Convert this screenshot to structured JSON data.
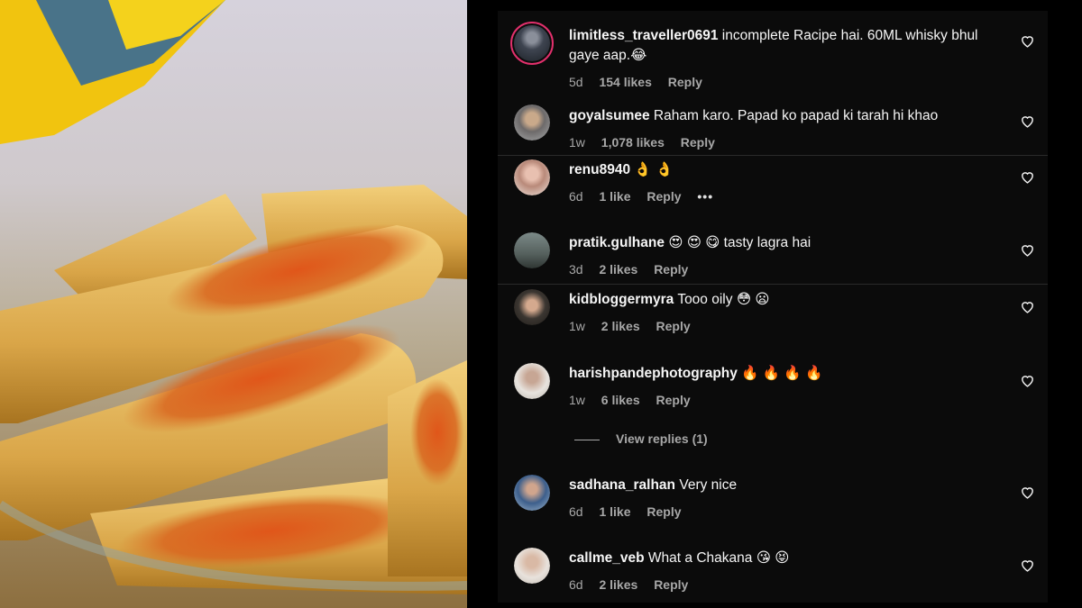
{
  "photo": {
    "description_icon": "food-photo"
  },
  "comments": [
    {
      "username": "limitless_traveller0691",
      "text": "incomplete Racipe hai. 60ML whisky bhul gaye aap.",
      "emoji": "😂",
      "time": "5d",
      "likes": "154 likes",
      "reply": "Reply"
    },
    {
      "username": "goyalsumee",
      "text": "Raham karo. Papad ko papad ki tarah hi khao",
      "emoji": "",
      "time": "1w",
      "likes": "1,078 likes",
      "reply": "Reply"
    },
    {
      "username": "renu8940",
      "text": "",
      "emoji": "👌 👌",
      "time": "6d",
      "likes": "1 like",
      "reply": "Reply",
      "more": "•••"
    },
    {
      "username": "pratik.gulhane",
      "text": "tasty lagra hai",
      "emoji": "😍 😍 😋",
      "time": "3d",
      "likes": "2 likes",
      "reply": "Reply"
    },
    {
      "username": "kidbloggermyra",
      "text": "Tooo oily",
      "emoji": "😳 😦",
      "time": "1w",
      "likes": "2 likes",
      "reply": "Reply"
    },
    {
      "username": "harishpandephotography",
      "text": "",
      "emoji": "🔥 🔥 🔥 🔥",
      "time": "1w",
      "likes": "6 likes",
      "reply": "Reply",
      "view_replies": "View replies (1)"
    },
    {
      "username": "sadhana_ralhan",
      "text": "Very nice",
      "emoji": "",
      "time": "6d",
      "likes": "1 like",
      "reply": "Reply"
    },
    {
      "username": "callme_veb",
      "text": "What a Chakana",
      "emoji": "😘 😝",
      "time": "6d",
      "likes": "2 likes",
      "reply": "Reply"
    }
  ],
  "colors": {
    "panel_bg": "#0b0b0b",
    "text": "#f5f5f5",
    "muted": "#a8a8a8",
    "story_ring": "#e1306c"
  },
  "icons": {
    "like": "heart-outline-icon"
  }
}
